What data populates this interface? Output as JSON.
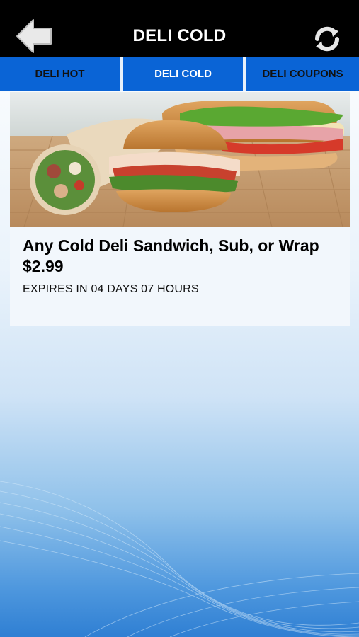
{
  "header": {
    "title": "DELI COLD",
    "back_icon": "back-arrow-icon",
    "refresh_icon": "refresh-icon"
  },
  "tabs": [
    {
      "label": "DELI HOT",
      "active": false
    },
    {
      "label": "DELI COLD",
      "active": true
    },
    {
      "label": "DELI COUPONS",
      "active": false
    }
  ],
  "deal": {
    "title": "Any Cold Deli Sandwich, Sub, or Wrap",
    "price": "$2.99",
    "expiry": "EXPIRES IN 04 DAYS 07 HOURS"
  },
  "colors": {
    "topbar": "#000000",
    "tab_bar": "#0a64d6",
    "active_tab_text": "#ffffff"
  }
}
